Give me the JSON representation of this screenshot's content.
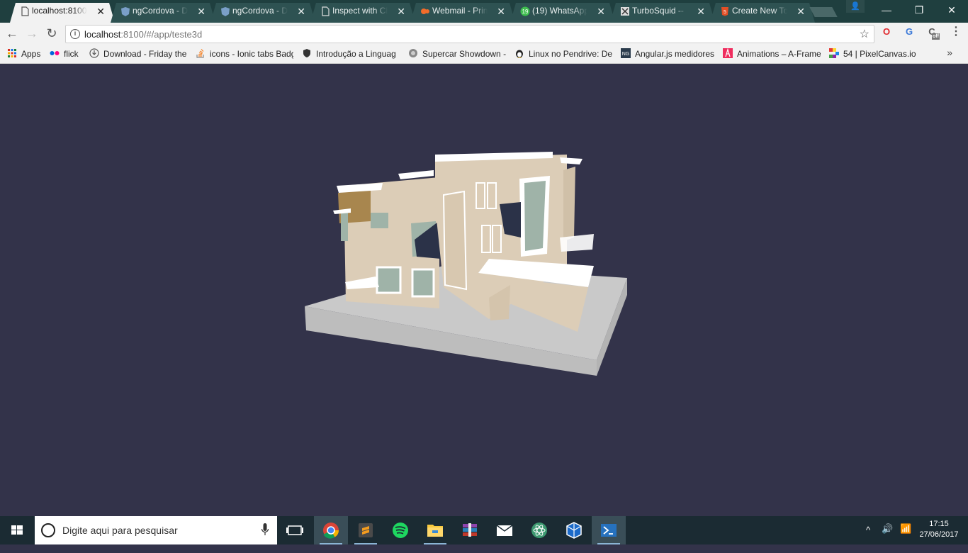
{
  "browser": {
    "tabs": [
      {
        "label": "localhost:8100/",
        "icon": "page-icon",
        "active": true
      },
      {
        "label": "ngCordova - D",
        "icon": "angular-shield-icon",
        "active": false
      },
      {
        "label": "ngCordova - D",
        "icon": "angular-shield-icon",
        "active": false
      },
      {
        "label": "Inspect with Ch",
        "icon": "page-icon",
        "active": false
      },
      {
        "label": "Webmail - Prin",
        "icon": "cpanel-icon",
        "active": false
      },
      {
        "label": "(19) WhatsApp",
        "icon": "whatsapp-icon",
        "active": false
      },
      {
        "label": "TurboSquid -- ",
        "icon": "turbosquid-icon",
        "active": false
      },
      {
        "label": "Create New Top",
        "icon": "html5-icon",
        "active": false
      }
    ],
    "tab_close_glyph": "✕",
    "window": {
      "user": "👤",
      "minimize": "—",
      "restore": "❐",
      "close": "✕"
    },
    "address": {
      "host": "localhost",
      "path": ":8100/#/app/teste3d",
      "info_glyph": "i",
      "star_glyph": "☆"
    },
    "nav": {
      "back": "←",
      "forward": "→",
      "reload": "↻"
    },
    "extensions": [
      {
        "name": "opera-extension-icon",
        "glyph": "O",
        "color": "#e0262b"
      },
      {
        "name": "translate-extension-icon",
        "glyph": "G",
        "color": "#3a78d8"
      },
      {
        "name": "grey-extension-icon",
        "glyph": "C",
        "color": "#555555"
      },
      {
        "name": "menu-icon",
        "glyph": "⋮",
        "color": "#555555"
      }
    ],
    "extension_badge": "off",
    "bookmarks": [
      {
        "label": "Apps",
        "icon": "apps-grid-icon"
      },
      {
        "label": "flick",
        "icon": "flickr-icon"
      },
      {
        "label": "Download - Friday the",
        "icon": "download-icon"
      },
      {
        "label": "icons - Ionic tabs Badg",
        "icon": "stackoverflow-icon"
      },
      {
        "label": "Introdução a Linguag",
        "icon": "shield-icon"
      },
      {
        "label": "Supercar Showdown -",
        "icon": "wheel-icon"
      },
      {
        "label": "Linux no Pendrive: De",
        "icon": "tux-icon"
      },
      {
        "label": "Angular.js medidores",
        "icon": "ng-icon"
      },
      {
        "label": "Animations – A-Frame",
        "icon": "aframe-icon"
      },
      {
        "label": "54 | PixelCanvas.io",
        "icon": "pixelcanvas-icon"
      }
    ],
    "bookmarks_more": "»",
    "brand_colors": {
      "tabstrip": "#1f3f3f",
      "viewport": "#33334a",
      "taskbar": "#1b2b33"
    }
  },
  "viewport": {
    "scene_subject": "3d-house-model",
    "colors": {
      "walls": "#dccdb7",
      "ground": "#c8c8c8",
      "glass": "#9fb3a8",
      "trim": "#ffffff",
      "wood": "#a8864e"
    }
  },
  "taskbar": {
    "search_placeholder": "Digite aqui para pesquisar",
    "apps": [
      {
        "name": "task-view-icon",
        "active": false
      },
      {
        "name": "chrome-icon",
        "active": true
      },
      {
        "name": "sublime-text-icon",
        "active": false
      },
      {
        "name": "spotify-icon",
        "active": false
      },
      {
        "name": "file-explorer-icon",
        "active": false
      },
      {
        "name": "winrar-icon",
        "active": false
      },
      {
        "name": "mail-icon",
        "active": false
      },
      {
        "name": "atom-icon",
        "active": false
      },
      {
        "name": "virtualbox-icon",
        "active": false
      },
      {
        "name": "powershell-icon",
        "active": false
      }
    ],
    "tray": {
      "chevron": "^",
      "volume": "🔊",
      "network": "📶"
    },
    "time": "17:15",
    "date": "27/06/2017"
  }
}
